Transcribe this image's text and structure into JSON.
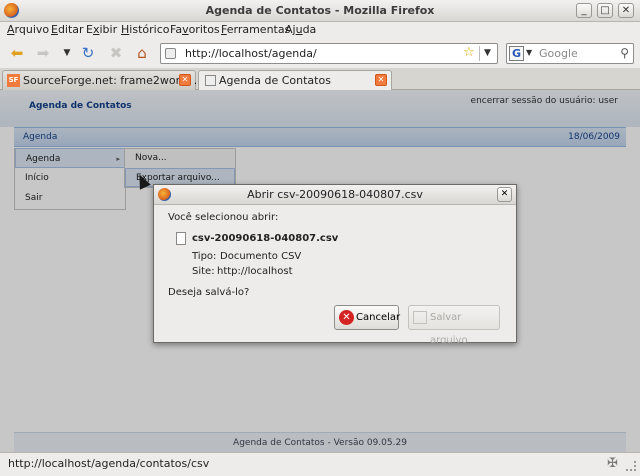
{
  "window": {
    "title": "Agenda de Contatos - Mozilla Firefox",
    "minimize": "_",
    "maximize": "□",
    "close": "✕"
  },
  "menu": {
    "items": [
      {
        "pre": "",
        "acc": "A",
        "post": "rquivo"
      },
      {
        "pre": "",
        "acc": "E",
        "post": "ditar"
      },
      {
        "pre": "E",
        "acc": "x",
        "post": "ibir"
      },
      {
        "pre": "",
        "acc": "H",
        "post": "istórico"
      },
      {
        "pre": "Fa",
        "acc": "v",
        "post": "oritos"
      },
      {
        "pre": "",
        "acc": "F",
        "post": "erramentas"
      },
      {
        "pre": "Aj",
        "acc": "u",
        "post": "da"
      }
    ]
  },
  "navigation": {
    "url": "http://localhost/agenda/",
    "search_placeholder": "Google",
    "search_engine_letter": "G"
  },
  "tabs": [
    {
      "icon_text": "SF",
      "label": "SourceForge.net: frame2work: ...",
      "active": false
    },
    {
      "icon_text": "",
      "label": "Agenda de Contatos",
      "active": true
    }
  ],
  "page": {
    "app_title": "Agenda de Contatos",
    "logout_text": "encerrar sessão do usuário: user",
    "section_label": "Agenda",
    "section_date": "18/06/2009",
    "left_menu": [
      {
        "label": "Agenda",
        "arrow": "▸"
      },
      {
        "label": "Início"
      },
      {
        "label": "Sair"
      }
    ],
    "submenu": [
      {
        "label": "Nova..."
      },
      {
        "label": "Exportar arquivo..."
      }
    ],
    "footer": "Agenda de Contatos - Versão 09.05.29"
  },
  "dialog": {
    "title": "Abrir csv-20090618-040807.csv",
    "prompt": "Você selecionou abrir:",
    "filename": "csv-20090618-040807.csv",
    "type_label": "Tipo:",
    "type_value": "Documento CSV",
    "site_label": "Site:",
    "site_value": "http://localhost",
    "question": "Deseja salvá-lo?",
    "cancel_label": "Cancelar",
    "save_label": "Salvar arquivo",
    "close": "✕"
  },
  "status": {
    "text": "http://localhost/agenda/contatos/csv"
  }
}
